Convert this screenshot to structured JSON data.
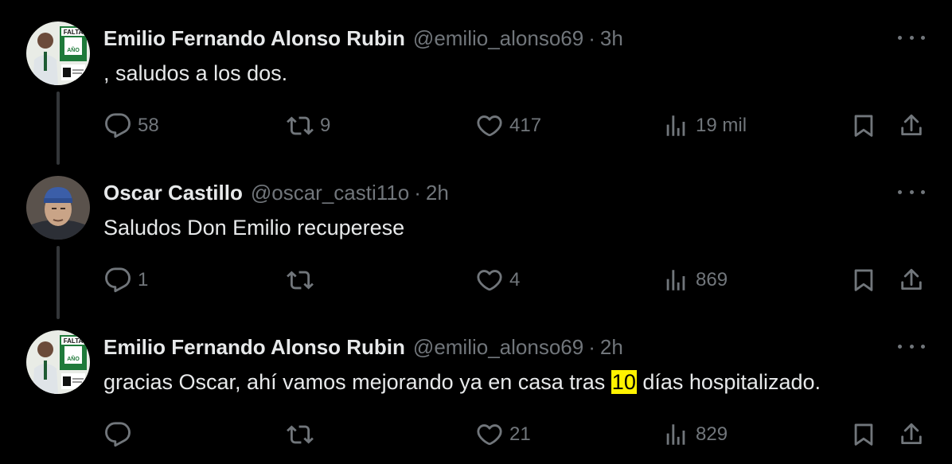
{
  "tweets": [
    {
      "name": "Emilio Fernando Alonso Rubin",
      "handle": "@emilio_alonso69",
      "separator": "·",
      "time": "3h",
      "text": ", saludos a los dos.",
      "avatar_badge": "FALTA",
      "avatar_label": "AÑO",
      "stats": {
        "replies": "58",
        "retweets": "9",
        "likes": "417",
        "views": "19 mil"
      }
    },
    {
      "name": "Oscar Castillo",
      "handle": "@oscar_casti11o",
      "separator": "·",
      "time": "2h",
      "text": "Saludos Don Emilio recuperese",
      "stats": {
        "replies": "1",
        "retweets": "",
        "likes": "4",
        "views": "869"
      }
    },
    {
      "name": "Emilio Fernando Alonso Rubin",
      "handle": "@emilio_alonso69",
      "separator": "·",
      "time": "2h",
      "text_before": "gracias Oscar, ahí vamos mejorando ya en casa tras ",
      "text_highlight": "10",
      "text_after": " días hospitalizado.",
      "avatar_badge": "FALTA",
      "avatar_label": "AÑO",
      "stats": {
        "replies": "",
        "retweets": "",
        "likes": "21",
        "views": "829"
      }
    }
  ],
  "colors": {
    "background": "#000000",
    "text": "#e7e9ea",
    "muted": "#71767b",
    "highlight": "#fff200",
    "thread_line": "#333639"
  },
  "icons": [
    "reply-icon",
    "retweet-icon",
    "like-icon",
    "views-icon",
    "bookmark-icon",
    "share-icon",
    "more-icon"
  ]
}
